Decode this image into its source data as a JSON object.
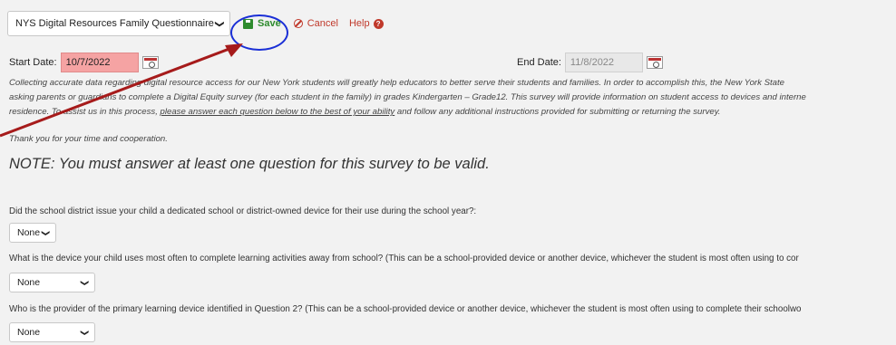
{
  "toolbar": {
    "survey_select_value": "NYS Digital Resources Family Questionnaire",
    "save_label": "Save",
    "cancel_label": "Cancel",
    "help_label": "Help"
  },
  "dates": {
    "start_label": "Start Date:",
    "start_value": "10/7/2022",
    "end_label": "End Date:",
    "end_value": "11/8/2022"
  },
  "intro": {
    "line1": "Collecting accurate data regarding digital resource access for our New York students will greatly help educators to better serve their students and families. In order to accomplish this, the New York State",
    "line2": "asking parents or guardians to complete a Digital Equity survey (for each student in the family) in grades Kindergarten – Grade12. This survey will provide information on student access to devices and interne",
    "line3_start": "residence. To assist us in this process, ",
    "line3_link": "please answer each question below to the best of your ability",
    "line3_end": " and follow any additional instructions provided for submitting or returning the survey."
  },
  "thanks": "Thank you for your time and cooperation.",
  "note": "NOTE: You must answer at least one question for this survey to be valid.",
  "questions": [
    {
      "text": "Did the school district issue your child a dedicated school or district-owned device for their use during the school year?:",
      "value": "None"
    },
    {
      "text": "What is the device your child uses most often to complete learning activities away from school? (This can be a school-provided device or another device, whichever the student is most often using to cor",
      "value": "None"
    },
    {
      "text": "Who is the provider of the primary learning device identified in Question 2? (This can be a school-provided device or another device, whichever the student is most often using to complete their schoolwo",
      "value": "None"
    }
  ],
  "colors": {
    "save": "#2e8b2e",
    "cancel": "#c0392b",
    "annotation_circle": "#1a2fd6",
    "annotation_arrow": "#a61b1b",
    "start_date_bg": "#f5a3a3"
  }
}
